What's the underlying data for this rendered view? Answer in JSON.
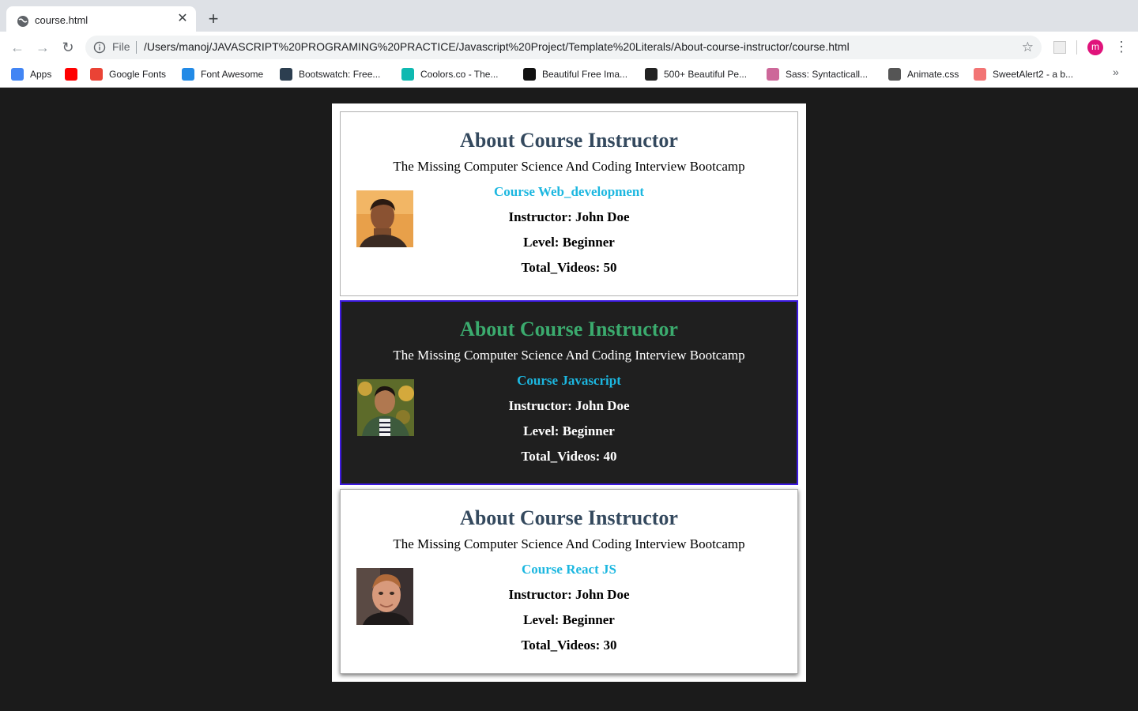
{
  "browser": {
    "tab_title": "course.html",
    "new_tab_symbol": "+",
    "close_symbol": "✕",
    "scheme_label": "File",
    "url": "/Users/manoj/JAVASCRIPT%20PROGRAMING%20PRACTICE/Javascript%20Project/Template%20Literals/About-course-instructor/course.html",
    "profile_initial": "m",
    "bookmarks": [
      {
        "label": "Apps",
        "icon": "apps-grid-icon",
        "color": "#4285f4"
      },
      {
        "label": "",
        "icon": "youtube-icon",
        "color": "#ff0000"
      },
      {
        "label": "Google Fonts",
        "icon": "google-fonts-icon",
        "color": "#ea4335"
      },
      {
        "label": "Font Awesome",
        "icon": "font-awesome-icon",
        "color": "#228ae6"
      },
      {
        "label": "Bootswatch: Free...",
        "icon": "bootswatch-icon",
        "color": "#2c3e50"
      },
      {
        "label": "Coolors.co - The...",
        "icon": "coolors-icon",
        "color": "#0fb9b1"
      },
      {
        "label": "Beautiful Free Ima...",
        "icon": "unsplash-icon",
        "color": "#111111"
      },
      {
        "label": "500+ Beautiful Pe...",
        "icon": "camera-icon",
        "color": "#222222"
      },
      {
        "label": "Sass: Syntacticall...",
        "icon": "sass-icon",
        "color": "#cd6799"
      },
      {
        "label": "Animate.css",
        "icon": "globe-icon",
        "color": "#555555"
      },
      {
        "label": "SweetAlert2 - a b...",
        "icon": "sweetalert-icon",
        "color": "#f27474"
      }
    ]
  },
  "cards": [
    {
      "heading": "About Course Instructor",
      "subtitle": "The Missing Computer Science And Coding Interview Bootcamp",
      "course": "Course Web_development",
      "instructor": "Instructor: John Doe",
      "level": "Level: Beginner",
      "videos": "Total_Videos: 50"
    },
    {
      "heading": "About Course Instructor",
      "subtitle": "The Missing Computer Science And Coding Interview Bootcamp",
      "course": "Course Javascript",
      "instructor": "Instructor: John Doe",
      "level": "Level: Beginner",
      "videos": "Total_Videos: 40"
    },
    {
      "heading": "About Course Instructor",
      "subtitle": "The Missing Computer Science And Coding Interview Bootcamp",
      "course": "Course React JS",
      "instructor": "Instructor: John Doe",
      "level": "Level: Beginner",
      "videos": "Total_Videos: 30"
    }
  ],
  "colors": {
    "page_background": "#1b1b1b",
    "heading": "#34495e",
    "heading_dark_card": "#3bab6e",
    "course_link": "#1cb7e0",
    "dark_card_border": "#3d1ae0"
  }
}
